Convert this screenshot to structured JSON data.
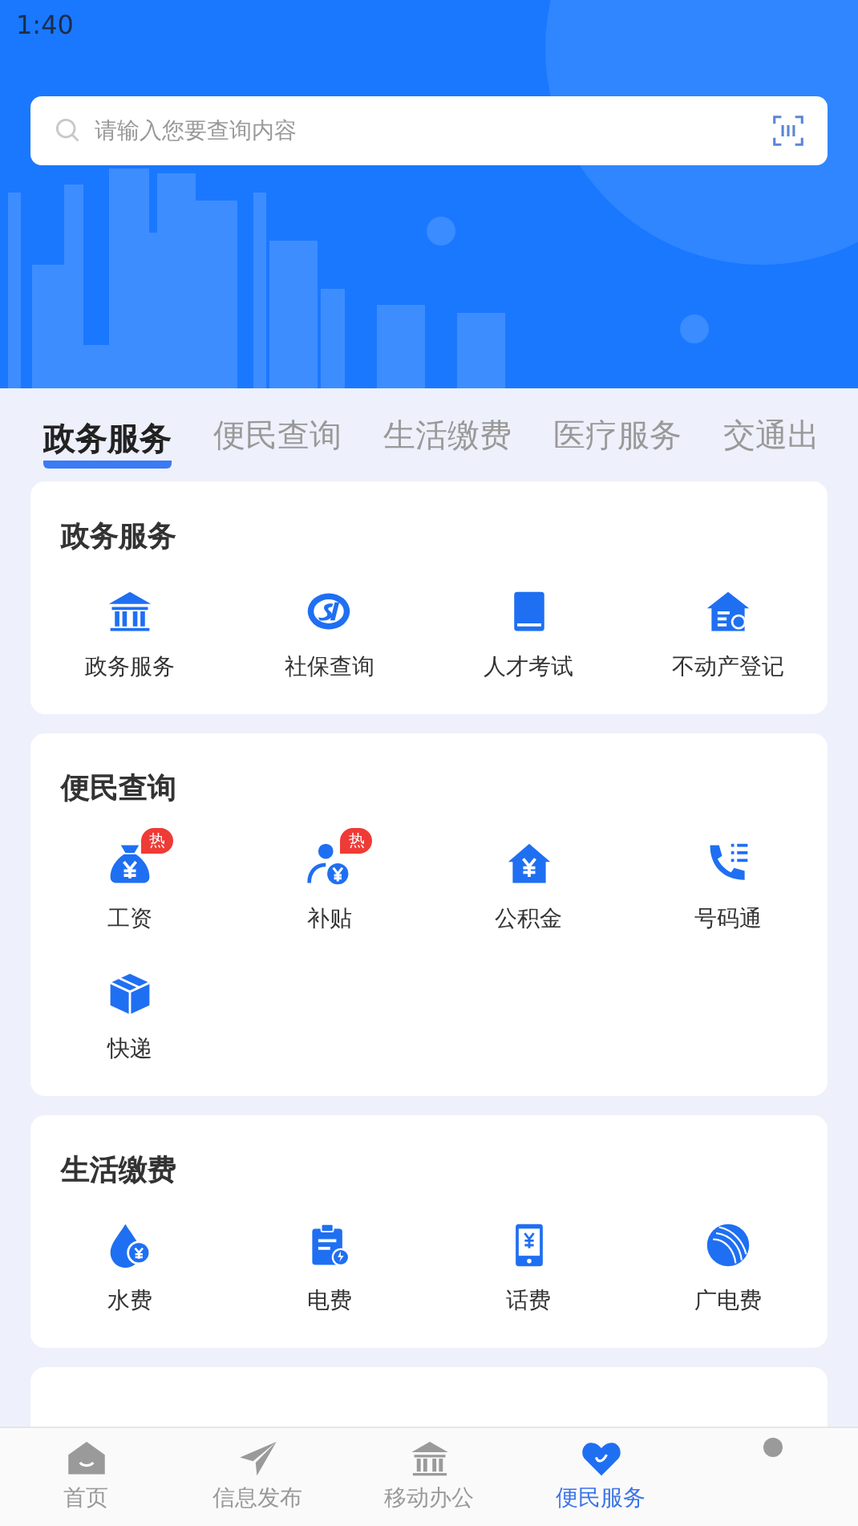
{
  "status_bar": {
    "time": "1:40"
  },
  "search": {
    "placeholder": "请输入您要查询内容"
  },
  "tabs": [
    {
      "label": "政务服务",
      "selected": true
    },
    {
      "label": "便民查询",
      "selected": false
    },
    {
      "label": "生活缴费",
      "selected": false
    },
    {
      "label": "医疗服务",
      "selected": false
    },
    {
      "label": "交通出",
      "selected": false
    }
  ],
  "sections": [
    {
      "title": "政务服务",
      "items": [
        {
          "label": "政务服务"
        },
        {
          "label": "社保查询"
        },
        {
          "label": "人才考试"
        },
        {
          "label": "不动产登记"
        }
      ]
    },
    {
      "title": "便民查询",
      "items": [
        {
          "label": "工资",
          "badge": "热"
        },
        {
          "label": "补贴",
          "badge": "热"
        },
        {
          "label": "公积金"
        },
        {
          "label": "号码通"
        },
        {
          "label": "快递"
        }
      ]
    },
    {
      "title": "生活缴费",
      "items": [
        {
          "label": "水费"
        },
        {
          "label": "电费"
        },
        {
          "label": "话费"
        },
        {
          "label": "广电费"
        }
      ]
    }
  ],
  "bottom_nav": [
    {
      "label": "首页",
      "selected": false
    },
    {
      "label": "信息发布",
      "selected": false
    },
    {
      "label": "移动办公",
      "selected": false
    },
    {
      "label": "便民服务",
      "selected": true
    },
    {
      "selected": false
    }
  ]
}
